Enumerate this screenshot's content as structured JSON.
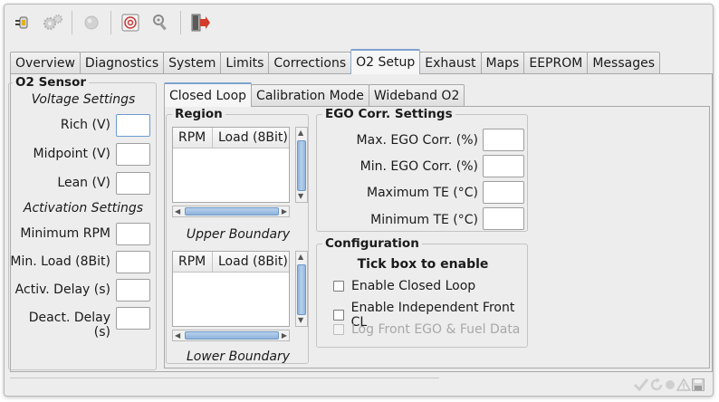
{
  "toolbar": {
    "buttons": [
      {
        "icon": "plug-connect-icon"
      },
      {
        "icon": "gears-icon"
      },
      {
        "icon": "record-icon"
      },
      {
        "icon": "target-icon"
      },
      {
        "icon": "wrench-key-icon"
      },
      {
        "icon": "exit-door-icon"
      }
    ]
  },
  "main_tabs": [
    "Overview",
    "Diagnostics",
    "System",
    "Limits",
    "Corrections",
    "O2 Setup",
    "Exhaust",
    "Maps",
    "EEPROM",
    "Messages"
  ],
  "o2_sensor": {
    "title": "O2 Sensor",
    "voltage_heading": "Voltage Settings",
    "rich": "Rich (V)",
    "midpoint": "Midpoint (V)",
    "lean": "Lean (V)",
    "activation_heading": "Activation Settings",
    "min_rpm": "Minimum RPM",
    "min_load": "Min. Load (8Bit)",
    "activ_delay": "Activ. Delay (s)",
    "deact_delay": "Deact. Delay (s)"
  },
  "sub_tabs": [
    "Closed Loop",
    "Calibration Mode",
    "Wideband O2"
  ],
  "region": {
    "title": "Region",
    "columns": [
      "RPM",
      "Load (8Bit)"
    ],
    "upper_label": "Upper Boundary",
    "lower_label": "Lower Boundary"
  },
  "ego": {
    "title": "EGO Corr. Settings",
    "max_corr": "Max. EGO Corr. (%)",
    "min_corr": "Min. EGO Corr. (%)",
    "max_te": "Maximum TE (°C)",
    "min_te": "Minimum TE (°C)"
  },
  "configuration": {
    "title": "Configuration",
    "heading": "Tick box to enable",
    "enable_closed_loop": "Enable Closed Loop",
    "enable_front_cl": "Enable Independent Front CL",
    "log_front": "Log Front EGO & Fuel Data"
  },
  "status_icons": [
    "check-icon",
    "refresh-icon",
    "dot-icon",
    "warning-icon",
    "save-icon"
  ],
  "colors": {
    "accent": "#7ea2cc",
    "exit_red": "#d23a2a",
    "scroll_blue": "#8fb3dc"
  }
}
